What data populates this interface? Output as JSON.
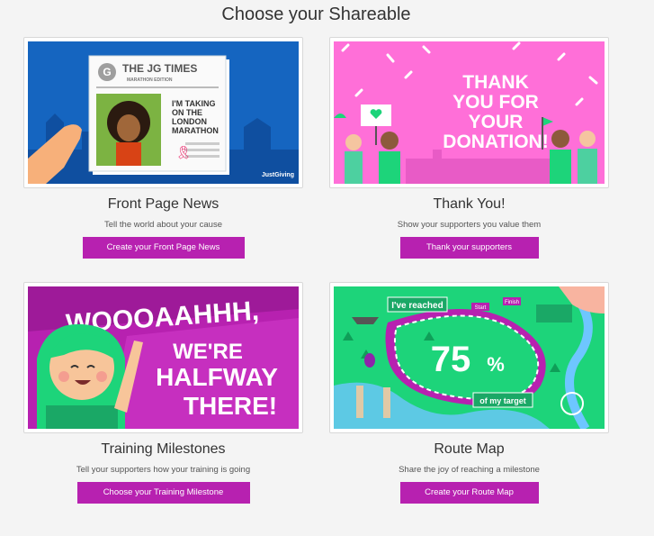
{
  "page": {
    "title": "Choose your Shareable"
  },
  "cards": [
    {
      "title": "Front Page News",
      "description": "Tell the world about your cause",
      "button": "Create your Front Page News",
      "image": {
        "logo_letter": "G",
        "masthead": "THE JG TIMES",
        "edition": "MARATHON EDITION",
        "headline_1": "I'M TAKING",
        "headline_2": "ON THE",
        "headline_3": "LONDON",
        "headline_4": "MARATHON",
        "brand": "JustGiving",
        "bg_color": "#1565c0"
      }
    },
    {
      "title": "Thank You!",
      "description": "Show your supporters you value them",
      "button": "Thank your supporters",
      "image": {
        "line_1": "THANK",
        "line_2": "YOU FOR",
        "line_3": "YOUR",
        "line_4": "DONATION!",
        "bg_color": "#ff6fd8"
      }
    },
    {
      "title": "Training Milestones",
      "description": "Tell your supporters how your training is going",
      "button": "Choose your Training Milestone",
      "image": {
        "line_1": "WOOOAAHHH,",
        "line_2": "WE'RE",
        "line_3": "HALFWAY",
        "line_4": "THERE!",
        "bg_color": "#b721b0"
      }
    },
    {
      "title": "Route Map",
      "description": "Share the joy of reaching a milestone",
      "button": "Create your Route Map",
      "image": {
        "reached": "I've reached",
        "start": "Start",
        "finish": "Finish",
        "percent": "75",
        "percent_sign": "%",
        "target": "of my target",
        "bg_color": "#1dd47a"
      }
    }
  ],
  "colors": {
    "accent": "#b721b0"
  }
}
